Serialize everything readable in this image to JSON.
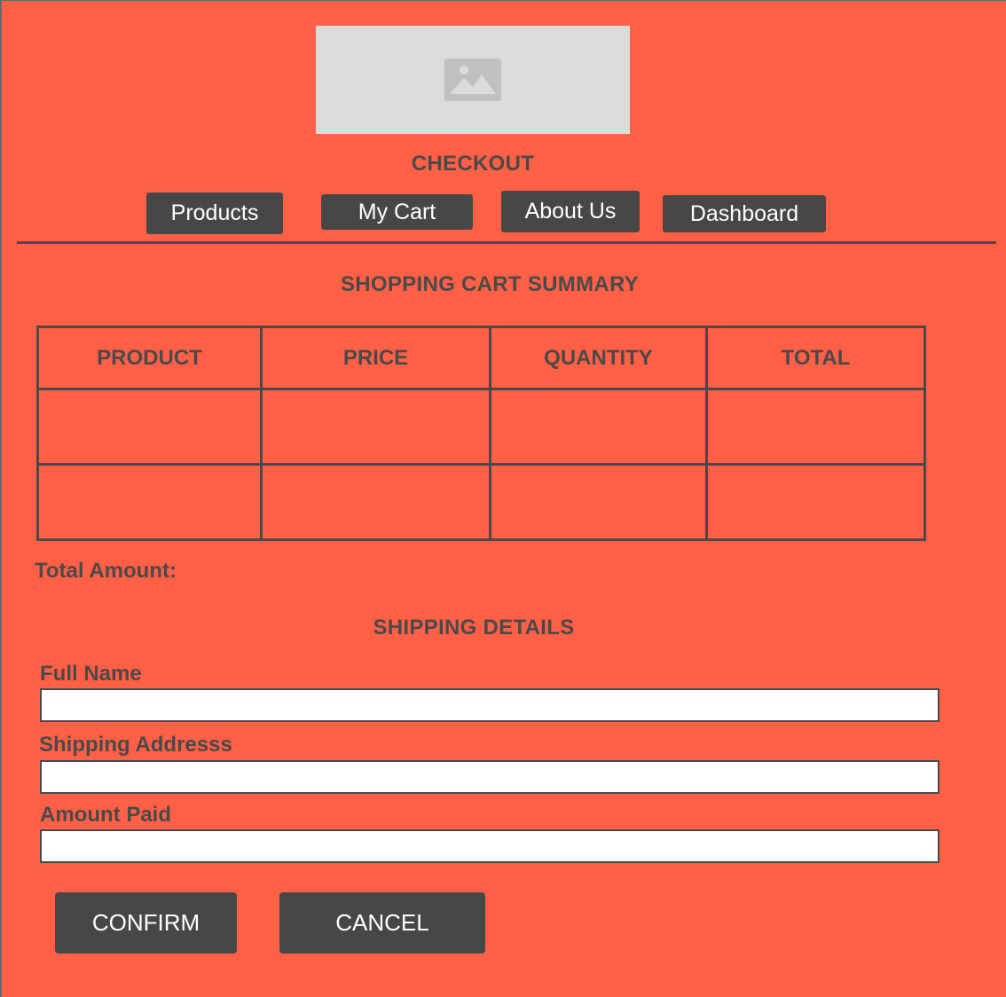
{
  "header": {
    "logo_icon": "image-placeholder-icon",
    "title": "CHECKOUT"
  },
  "nav": {
    "items": [
      {
        "label": "Products"
      },
      {
        "label": "My Cart"
      },
      {
        "label": "About Us"
      },
      {
        "label": "Dashboard"
      }
    ]
  },
  "cart": {
    "title": "SHOPPING CART SUMMARY",
    "columns": [
      "PRODUCT",
      "PRICE",
      "QUANTITY",
      "TOTAL"
    ],
    "rows": [
      [
        "",
        "",
        "",
        ""
      ],
      [
        "",
        "",
        "",
        ""
      ]
    ],
    "total_label": "Total Amount:"
  },
  "shipping": {
    "title": "SHIPPING DETAILS",
    "fields": [
      {
        "label": "Full Name",
        "value": "",
        "placeholder": ""
      },
      {
        "label": "Shipping Addresss",
        "value": "",
        "placeholder": ""
      },
      {
        "label": "Amount Paid",
        "value": "",
        "placeholder": ""
      }
    ]
  },
  "actions": {
    "confirm_label": "CONFIRM",
    "cancel_label": "CANCEL"
  },
  "colors": {
    "background": "#ff6046",
    "button": "#474747",
    "text": "#4a4a4a",
    "placeholder_box": "#d9dcd8"
  }
}
